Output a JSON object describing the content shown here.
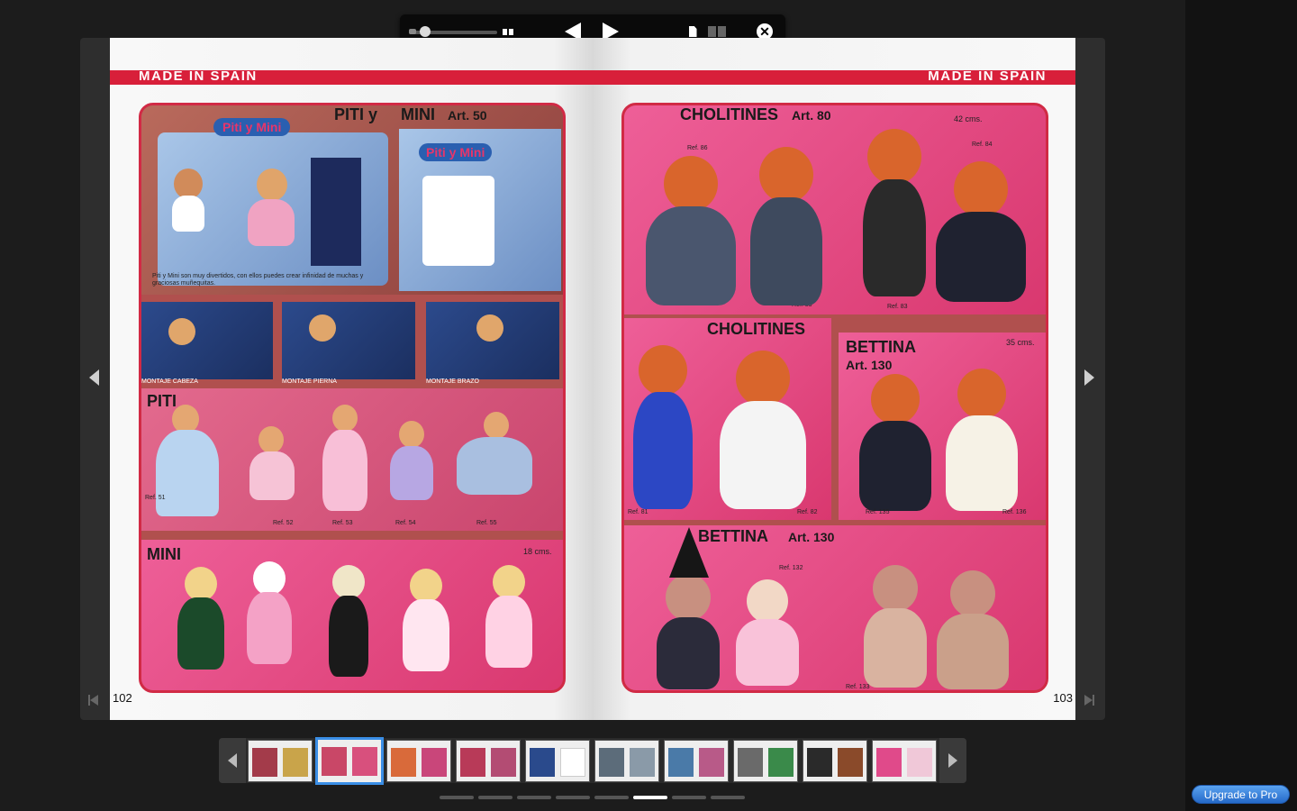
{
  "toolbar": {
    "zoom_icon": "zoom-slider",
    "two_page_icon": "two-page-view-icon",
    "prev_icon": "triangle-left-icon",
    "next_icon": "triangle-right-icon",
    "single_view_icon": "single-page-icon",
    "double_view_icon": "double-page-icon",
    "close_label": "✕"
  },
  "left_page": {
    "header": "MADE IN SPAIN",
    "page_number": "102",
    "title_piti_mini": "PITI y",
    "title_mini_art": "MINI",
    "title_art": "Art. 50",
    "box_logo": "Piti y Mini",
    "box_text": "Piti y Mini son muy divertidos, con ellos puedes crear infinidad de muchas y graciosas muñequitas.",
    "caption_cabeza": "MONTAJE CABEZA",
    "caption_pierna": "MONTAJE PIERNA",
    "caption_brazo": "MONTAJE BRAZO",
    "section_piti": "PITI",
    "section_mini": "MINI",
    "size_mini": "18 cms.",
    "refs_piti": [
      "Ref. 51",
      "Ref. 52",
      "Ref. 53",
      "Ref. 54",
      "Ref. 55"
    ]
  },
  "right_page": {
    "header": "MADE IN SPAIN",
    "page_number": "103",
    "title_cholitines": "CHOLITINES",
    "title_cholitines_art": "Art. 80",
    "size_cholitines": "42 cms.",
    "refs_cholitines_top": [
      "Ref. 86",
      "Ref. 84",
      "Ref. 85",
      "Ref. 83"
    ],
    "title_cholitines_2": "CHOLITINES",
    "refs_cholitines_mid": [
      "Ref. 81",
      "Ref. 82"
    ],
    "title_bettina": "BETTINA",
    "title_bettina_art": "Art. 130",
    "size_bettina": "35 cms.",
    "refs_bettina_mid": [
      "Ref. 135",
      "Ref. 136"
    ],
    "title_bettina_2": "BETTINA",
    "title_bettina_2_art": "Art. 130",
    "refs_bettina_bottom": [
      "Ref. 132",
      "Ref. 133"
    ]
  },
  "thumbnails": {
    "active_index": 1,
    "count": 10
  },
  "page_dots": {
    "count": 8,
    "active_index": 5
  },
  "upgrade_label": "Upgrade to Pro",
  "colors": {
    "accent_red": "#d81f3a",
    "active_blue": "#3a8ee6"
  }
}
